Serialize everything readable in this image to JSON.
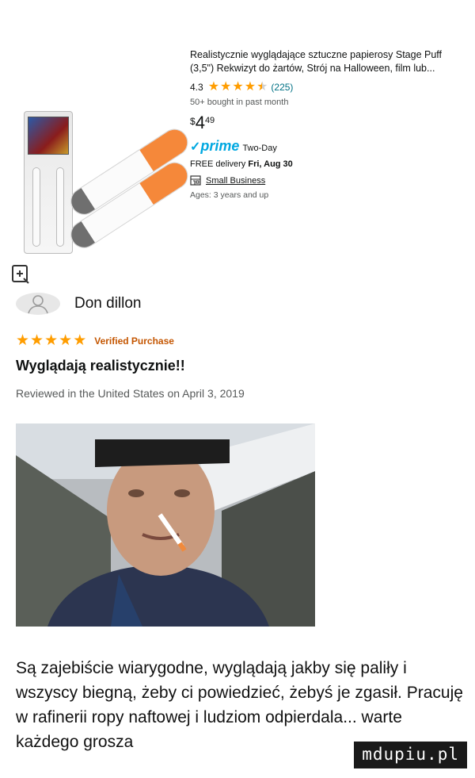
{
  "product": {
    "title": "Realistycznie wyglądające sztuczne papierosy Stage Puff (3,5\") Rekwizyt do żartów, Strój na Halloween, film lub...",
    "rating": "4.3",
    "rating_value": 4.3,
    "rating_max": 5,
    "review_count": "(225)",
    "bought": "50+ bought in past month",
    "price": {
      "currency": "$",
      "whole": "4",
      "fraction": "49"
    },
    "prime": {
      "check": "✓",
      "word": "prime",
      "label": "Two-Day"
    },
    "delivery": {
      "prefix": "FREE delivery",
      "date": "Fri, Aug 30"
    },
    "small_business": "Small Business",
    "ages": "Ages: 3 years and up"
  },
  "review": {
    "reviewer": "Don dillon",
    "stars_value": 5,
    "verified": "Verified Purchase",
    "title": "Wyglądają realistycznie!!",
    "date": "Reviewed in the United States on April 3, 2019"
  },
  "caption": "Są zajebiście wiarygodne, wyglądają jakby się paliły i wszyscy biegną, żeby ci powiedzieć, żebyś je zgasił. Pracuję w rafinerii ropy naftowej i ludziom odpierdala... warte każdego grosza",
  "watermark": "mdupiu.pl",
  "colors": {
    "star": "#ff9d00",
    "prime": "#00a8e1",
    "verified": "#c45500",
    "filter": "#f5883a"
  },
  "icons": [
    "zoom-icon",
    "star-icon",
    "shop-icon",
    "avatar-icon"
  ]
}
